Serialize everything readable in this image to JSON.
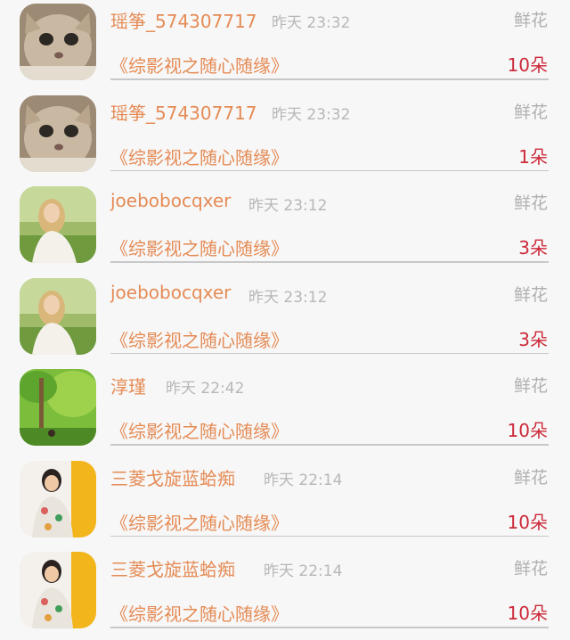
{
  "rows": [
    {
      "avatar": "cat-avatar",
      "name": "瑶筝_574307717",
      "time": "昨天  23:32",
      "gift": "鲜花",
      "show": "《综影视之随心随缘》",
      "count": "10朵"
    },
    {
      "avatar": "cat-avatar",
      "name": "瑶筝_574307717",
      "time": "昨天  23:32",
      "gift": "鲜花",
      "show": "《综影视之随心随缘》",
      "count": "1朵"
    },
    {
      "avatar": "girl-field-avatar",
      "name": "joebobocqxer",
      "time": "昨天  23:12",
      "gift": "鲜花",
      "show": "《综影视之随心随缘》",
      "count": "3朵"
    },
    {
      "avatar": "girl-field-avatar",
      "name": "joebobocqxer",
      "time": "昨天  23:12",
      "gift": "鲜花",
      "show": "《综影视之随心随缘》",
      "count": "3朵"
    },
    {
      "avatar": "forest-avatar",
      "name": "淳瑾",
      "time": "昨天  22:42",
      "gift": "鲜花",
      "show": "《综影视之随心随缘》",
      "count": "10朵"
    },
    {
      "avatar": "girl-yellow-avatar",
      "name": "三菱戈旋蓝蛤痴",
      "time": "昨天  22:14",
      "gift": "鲜花",
      "show": "《综影视之随心随缘》",
      "count": "10朵"
    },
    {
      "avatar": "girl-yellow-avatar",
      "name": "三菱戈旋蓝蛤痴",
      "time": "昨天  22:14",
      "gift": "鲜花",
      "show": "《综影视之随心随缘》",
      "count": "10朵"
    }
  ]
}
